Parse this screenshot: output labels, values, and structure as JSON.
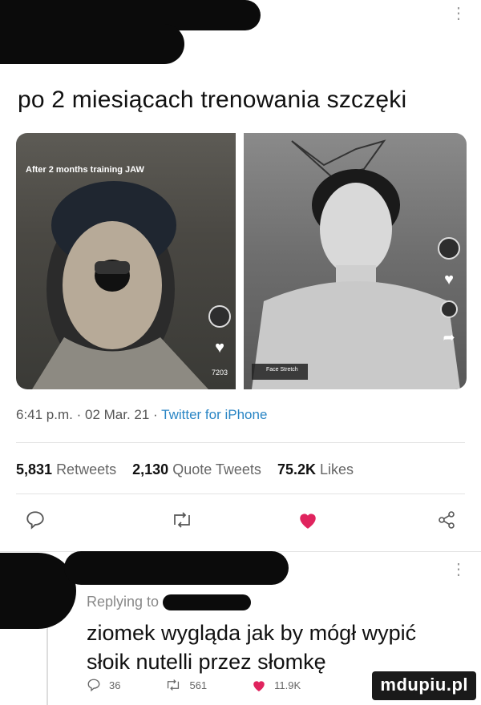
{
  "tweet": {
    "text": "po 2 miesiącach trenowania szczęki",
    "media_caption": "After 2 months training JAW",
    "media_counts": [
      "7203"
    ],
    "media_tag": "Face Stretch"
  },
  "meta": {
    "time": "6:41 p.m.",
    "sep1": " · ",
    "date": "02 Mar. 21",
    "sep2": " · ",
    "source": "Twitter for iPhone"
  },
  "stats": {
    "retweets_value": "5,831",
    "retweets_label": "Retweets",
    "quotes_value": "2,130",
    "quotes_label": "Quote Tweets",
    "likes_value": "75.2K",
    "likes_label": "Likes"
  },
  "reply": {
    "replying_to": "Replying to",
    "text_line1": "ziomek wygląda jak by mógł wypić",
    "text_line2": "słoik nutelli przez słomkę",
    "replies": "36",
    "retweets": "561",
    "likes": "11.9K"
  },
  "watermark": "mdupiu.pl",
  "colors": {
    "link": "#2b86c5",
    "like_red": "#e0245e",
    "muted": "#666666"
  },
  "icons": [
    "comment-icon",
    "retweet-icon",
    "heart-icon",
    "share-icon",
    "more-icon"
  ]
}
